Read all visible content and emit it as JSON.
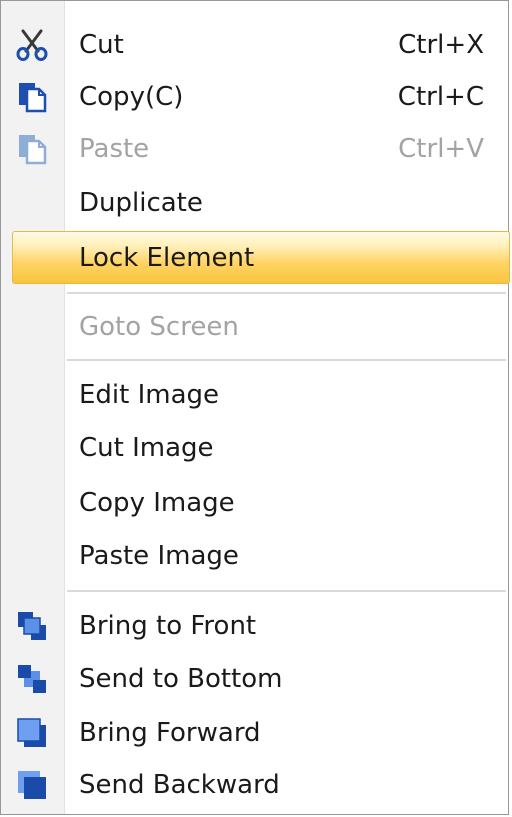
{
  "menu": {
    "items": [
      {
        "label": "Cut",
        "shortcut": "Ctrl+X",
        "icon": "scissors-icon"
      },
      {
        "label": "Copy(C)",
        "shortcut": "Ctrl+C",
        "icon": "copy-icon"
      },
      {
        "label": "Paste",
        "shortcut": "Ctrl+V",
        "icon": "paste-icon",
        "disabled": true
      },
      {
        "label": "Duplicate"
      },
      {
        "label": "Lock Element",
        "highlighted": true
      },
      {
        "label": "Goto Screen",
        "disabled": true
      },
      {
        "label": "Edit Image"
      },
      {
        "label": "Cut Image"
      },
      {
        "label": "Copy Image"
      },
      {
        "label": "Paste Image"
      },
      {
        "label": "Bring to Front",
        "icon": "bring-to-front-icon"
      },
      {
        "label": "Send to Bottom",
        "icon": "send-to-bottom-icon"
      },
      {
        "label": "Bring Forward",
        "icon": "bring-forward-icon"
      },
      {
        "label": "Send Backward",
        "icon": "send-backward-icon"
      }
    ]
  },
  "colors": {
    "highlight": "#ffd466",
    "gutter": "#f2f2f2",
    "disabled_text": "#a3a3a3",
    "icon_blue": "#1e5bc6"
  }
}
